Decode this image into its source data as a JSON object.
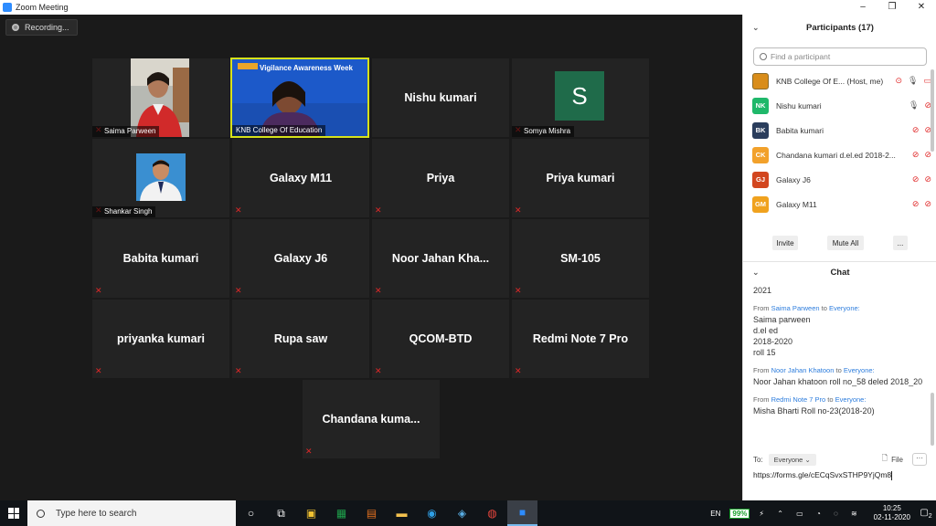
{
  "window": {
    "title": "Zoom Meeting",
    "controls": [
      "–",
      "❐",
      "✕"
    ]
  },
  "recording": {
    "label": "Recording..."
  },
  "gallery": {
    "tiles": [
      {
        "name": "Saima Parween",
        "type": "photo",
        "muted": true
      },
      {
        "name": "KNB College Of Education",
        "type": "video",
        "active": true,
        "banner": "Vigilance Awareness Week",
        "muted": false
      },
      {
        "name": "Nishu kumari",
        "type": "name",
        "muted": false
      },
      {
        "name": "Somya Mishra",
        "type": "avatar",
        "avatar_letter": "S",
        "muted": true
      },
      {
        "name": "Shankar Singh",
        "type": "photo",
        "muted": true
      },
      {
        "name": "Galaxy M11",
        "type": "name",
        "muted": true
      },
      {
        "name": "Priya",
        "type": "name",
        "muted": true
      },
      {
        "name": "Priya kumari",
        "type": "name",
        "muted": true
      },
      {
        "name": "Babita kumari",
        "type": "name",
        "muted": true
      },
      {
        "name": "Galaxy J6",
        "type": "name",
        "muted": true
      },
      {
        "name": "Noor  Jahan  Kha...",
        "type": "name",
        "muted": true
      },
      {
        "name": "SM-105",
        "type": "name",
        "muted": true
      },
      {
        "name": "priyanka kumari",
        "type": "name",
        "muted": true
      },
      {
        "name": "Rupa saw",
        "type": "name",
        "muted": true
      },
      {
        "name": "QCOM-BTD",
        "type": "name",
        "muted": true
      },
      {
        "name": "Redmi Note 7 Pro",
        "type": "name",
        "muted": true
      },
      {
        "name": "Chandana  kuma...",
        "type": "name",
        "muted": true
      }
    ]
  },
  "participants": {
    "title": "Participants (17)",
    "search_placeholder": "Find a participant",
    "list": [
      {
        "initials": "",
        "name": "KNB College Of E...   (Host, me)",
        "color": "#d98d1a",
        "muted": false
      },
      {
        "initials": "NK",
        "name": "Nishu kumari",
        "color": "#1fb86a",
        "muted": false
      },
      {
        "initials": "BK",
        "name": "Babita kumari",
        "color": "#2a3d5c",
        "muted": true
      },
      {
        "initials": "CK",
        "name": "Chandana kumari d.el.ed 2018-2...",
        "color": "#f2a12b",
        "muted": true
      },
      {
        "initials": "GJ",
        "name": "Galaxy J6",
        "color": "#d2461f",
        "muted": true
      },
      {
        "initials": "GM",
        "name": "Galaxy M11",
        "color": "#f0a21e",
        "muted": true
      }
    ],
    "invite_label": "Invite",
    "mute_all_label": "Mute All",
    "more_label": "..."
  },
  "chat": {
    "title": "Chat",
    "top_fragment": "2021",
    "messages": [
      {
        "from": "Saima Parween",
        "to": "Everyone:",
        "lines": [
          "Saima parween",
          "d.el ed",
          "2018-2020",
          "roll 15"
        ]
      },
      {
        "from": "Noor Jahan Khatoon",
        "to": "Everyone:",
        "lines": [
          "Noor Jahan khatoon roll no_58 deled 2018_20"
        ]
      },
      {
        "from": "Redmi Note 7 Pro",
        "to": "Everyone:",
        "lines": [
          "Misha Bharti Roll no-23(2018-20)"
        ]
      }
    ],
    "from_word": "From",
    "to_word": "to",
    "to_label": "To:",
    "recipient": "Everyone",
    "file_label": "File",
    "more_label": "···",
    "draft": "https://forms.gle/cECqSvxSTHP9YjQm8"
  },
  "taskbar": {
    "search_placeholder": "Type here to search",
    "language": "EN",
    "battery": "99%",
    "time": "10:25",
    "date": "02-11-2020",
    "notification_count": "2"
  }
}
